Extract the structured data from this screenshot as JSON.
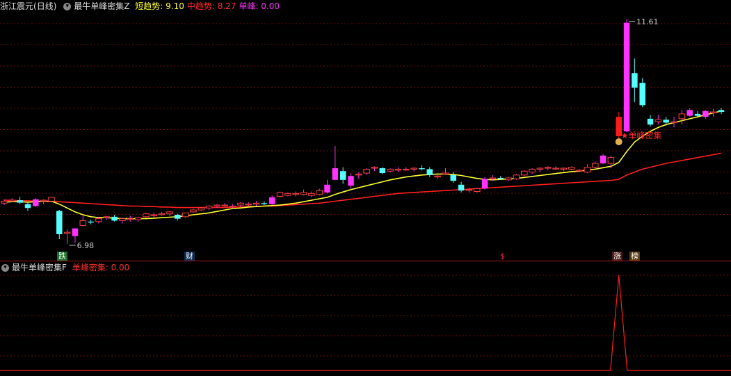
{
  "stock": {
    "name": "浙江震元",
    "period": "(日线)"
  },
  "main_indicator": {
    "name": "最牛单峰密集Z",
    "items": [
      {
        "label": "短趋势",
        "value": "9.10",
        "color": "#ffff33"
      },
      {
        "label": "中趋势",
        "value": "8.27",
        "color": "#ff3030"
      },
      {
        "label": "单峰",
        "value": "0.00",
        "color": "#ff33ff"
      }
    ]
  },
  "sub_indicator": {
    "name": "最牛单峰密集F",
    "items": [
      {
        "label": "单峰密集",
        "value": "0.00",
        "color": "#ff3030"
      }
    ]
  },
  "annotations": {
    "high_label": "11.61",
    "low_label": "6.98",
    "signal_label": "单峰密集",
    "markers": [
      {
        "text": "跌",
        "bg": "#1a6e2a",
        "fg": "#ffffff"
      },
      {
        "text": "财",
        "bg": "#0a2a55",
        "fg": "#ffffff"
      },
      {
        "text": "$",
        "bg": "#000000",
        "fg": "#ff3030"
      },
      {
        "text": "涨",
        "bg": "#4a1a1a",
        "fg": "#ffffff"
      },
      {
        "text": "榜",
        "bg": "#5a3a10",
        "fg": "#ffffff"
      }
    ]
  },
  "colors": {
    "up": "#ff33ff",
    "down": "#55ffff",
    "up_small": "#ff4040",
    "ma_short": "#ffff33",
    "ma_mid": "#ff2020"
  },
  "chart_data": {
    "type": "candlestick",
    "candles": [
      [
        7.82,
        7.9,
        7.78,
        7.86
      ],
      [
        7.86,
        7.92,
        7.84,
        7.88
      ],
      [
        7.88,
        7.95,
        7.8,
        7.83
      ],
      [
        7.8,
        7.84,
        7.66,
        7.72
      ],
      [
        7.76,
        7.92,
        7.74,
        7.9
      ],
      [
        7.87,
        7.9,
        7.8,
        7.88
      ],
      [
        7.86,
        7.94,
        7.84,
        7.94
      ],
      [
        7.66,
        7.68,
        7.08,
        7.18
      ],
      [
        7.2,
        7.28,
        6.98,
        7.22
      ],
      [
        7.14,
        7.3,
        7.0,
        7.3
      ],
      [
        7.36,
        7.56,
        7.34,
        7.46
      ],
      [
        7.44,
        7.48,
        7.38,
        7.42
      ],
      [
        7.44,
        7.54,
        7.4,
        7.5
      ],
      [
        7.52,
        7.56,
        7.48,
        7.54
      ],
      [
        7.54,
        7.58,
        7.44,
        7.46
      ],
      [
        7.46,
        7.52,
        7.4,
        7.5
      ],
      [
        7.5,
        7.56,
        7.44,
        7.5
      ],
      [
        7.48,
        7.54,
        7.44,
        7.52
      ],
      [
        7.54,
        7.62,
        7.52,
        7.6
      ],
      [
        7.58,
        7.62,
        7.52,
        7.58
      ],
      [
        7.6,
        7.64,
        7.56,
        7.6
      ],
      [
        7.6,
        7.66,
        7.56,
        7.64
      ],
      [
        7.58,
        7.6,
        7.46,
        7.5
      ],
      [
        7.54,
        7.62,
        7.52,
        7.62
      ],
      [
        7.64,
        7.7,
        7.62,
        7.68
      ],
      [
        7.68,
        7.74,
        7.66,
        7.72
      ],
      [
        7.72,
        7.78,
        7.68,
        7.76
      ],
      [
        7.76,
        7.8,
        7.72,
        7.78
      ],
      [
        7.78,
        7.82,
        7.74,
        7.78
      ],
      [
        7.76,
        7.8,
        7.72,
        7.76
      ],
      [
        7.78,
        7.84,
        7.74,
        7.82
      ],
      [
        7.8,
        7.84,
        7.76,
        7.8
      ],
      [
        7.8,
        7.86,
        7.76,
        7.82
      ],
      [
        7.82,
        7.86,
        7.78,
        7.8
      ],
      [
        7.8,
        7.98,
        7.78,
        7.94
      ],
      [
        7.96,
        8.06,
        7.94,
        8.04
      ],
      [
        7.98,
        8.04,
        7.96,
        8.02
      ],
      [
        8.0,
        8.06,
        7.96,
        8.02
      ],
      [
        8.0,
        8.1,
        7.98,
        8.04
      ],
      [
        7.98,
        8.06,
        7.94,
        8.02
      ],
      [
        8.0,
        8.12,
        7.98,
        8.08
      ],
      [
        8.04,
        8.3,
        8.02,
        8.2
      ],
      [
        8.3,
        9.0,
        8.3,
        8.54
      ],
      [
        8.48,
        8.56,
        8.22,
        8.3
      ],
      [
        8.18,
        8.44,
        8.12,
        8.38
      ],
      [
        8.4,
        8.46,
        8.32,
        8.42
      ],
      [
        8.44,
        8.54,
        8.4,
        8.52
      ],
      [
        8.54,
        8.58,
        8.48,
        8.56
      ],
      [
        8.54,
        8.56,
        8.42,
        8.44
      ],
      [
        8.48,
        8.54,
        8.46,
        8.52
      ],
      [
        8.5,
        8.56,
        8.46,
        8.52
      ],
      [
        8.52,
        8.56,
        8.48,
        8.52
      ],
      [
        8.52,
        8.56,
        8.48,
        8.54
      ],
      [
        8.54,
        8.6,
        8.5,
        8.52
      ],
      [
        8.52,
        8.56,
        8.36,
        8.4
      ],
      [
        8.36,
        8.44,
        8.32,
        8.38
      ],
      [
        8.42,
        8.54,
        8.4,
        8.44
      ],
      [
        8.4,
        8.46,
        8.24,
        8.28
      ],
      [
        8.2,
        8.26,
        8.04,
        8.08
      ],
      [
        8.1,
        8.14,
        8.04,
        8.1
      ],
      [
        8.06,
        8.14,
        8.04,
        8.12
      ],
      [
        8.12,
        8.36,
        8.1,
        8.32
      ],
      [
        8.32,
        8.4,
        8.28,
        8.34
      ],
      [
        8.34,
        8.38,
        8.3,
        8.32
      ],
      [
        8.3,
        8.36,
        8.28,
        8.34
      ],
      [
        8.32,
        8.42,
        8.3,
        8.4
      ],
      [
        8.4,
        8.5,
        8.38,
        8.48
      ],
      [
        8.46,
        8.54,
        8.42,
        8.52
      ],
      [
        8.52,
        8.56,
        8.46,
        8.54
      ],
      [
        8.54,
        8.58,
        8.5,
        8.56
      ],
      [
        8.54,
        8.58,
        8.5,
        8.54
      ],
      [
        8.52,
        8.56,
        8.48,
        8.54
      ],
      [
        8.52,
        8.58,
        8.5,
        8.56
      ],
      [
        8.5,
        8.52,
        8.46,
        8.5
      ],
      [
        8.46,
        8.62,
        8.44,
        8.56
      ],
      [
        8.56,
        8.68,
        8.52,
        8.64
      ],
      [
        8.64,
        8.84,
        8.62,
        8.8
      ],
      [
        8.64,
        8.8,
        8.54,
        8.76
      ],
      [
        9.6,
        9.7,
        9.16,
        9.2
      ],
      [
        9.3,
        11.61,
        9.28,
        11.54
      ],
      [
        10.5,
        10.8,
        9.9,
        10.2
      ],
      [
        10.3,
        10.4,
        9.8,
        9.84
      ],
      [
        9.56,
        9.64,
        9.4,
        9.44
      ],
      [
        9.5,
        9.64,
        9.44,
        9.54
      ],
      [
        9.54,
        9.6,
        9.42,
        9.48
      ],
      [
        9.48,
        9.6,
        9.38,
        9.5
      ],
      [
        9.56,
        9.74,
        9.44,
        9.66
      ],
      [
        9.62,
        9.78,
        9.6,
        9.74
      ],
      [
        9.66,
        9.72,
        9.58,
        9.62
      ],
      [
        9.6,
        9.74,
        9.56,
        9.72
      ],
      [
        9.68,
        9.76,
        9.6,
        9.7
      ],
      [
        9.74,
        9.78,
        9.66,
        9.7
      ]
    ],
    "ma_short": [
      7.84,
      7.85,
      7.85,
      7.84,
      7.85,
      7.86,
      7.86,
      7.8,
      7.72,
      7.64,
      7.58,
      7.54,
      7.52,
      7.52,
      7.51,
      7.5,
      7.5,
      7.5,
      7.5,
      7.51,
      7.52,
      7.53,
      7.54,
      7.56,
      7.58,
      7.6,
      7.62,
      7.65,
      7.68,
      7.71,
      7.72,
      7.74,
      7.75,
      7.76,
      7.77,
      7.78,
      7.8,
      7.82,
      7.85,
      7.88,
      7.91,
      7.94,
      8.0,
      8.05,
      8.1,
      8.14,
      8.18,
      8.22,
      8.26,
      8.3,
      8.33,
      8.36,
      8.38,
      8.4,
      8.41,
      8.42,
      8.42,
      8.41,
      8.39,
      8.36,
      8.33,
      8.31,
      8.3,
      8.31,
      8.32,
      8.33,
      8.35,
      8.37,
      8.39,
      8.41,
      8.43,
      8.45,
      8.47,
      8.48,
      8.5,
      8.52,
      8.55,
      8.58,
      8.66,
      8.88,
      9.08,
      9.2,
      9.3,
      9.38,
      9.44,
      9.48,
      9.52,
      9.56,
      9.6,
      9.64,
      9.68,
      9.72
    ],
    "ma_mid": [
      7.88,
      7.88,
      7.87,
      7.87,
      7.86,
      7.86,
      7.85,
      7.85,
      7.84,
      7.83,
      7.82,
      7.81,
      7.8,
      7.79,
      7.78,
      7.77,
      7.76,
      7.76,
      7.75,
      7.75,
      7.74,
      7.74,
      7.73,
      7.73,
      7.73,
      7.73,
      7.73,
      7.73,
      7.73,
      7.74,
      7.74,
      7.75,
      7.75,
      7.76,
      7.76,
      7.77,
      7.78,
      7.79,
      7.8,
      7.81,
      7.82,
      7.84,
      7.86,
      7.88,
      7.9,
      7.92,
      7.94,
      7.96,
      7.98,
      8.0,
      8.02,
      8.03,
      8.04,
      8.05,
      8.06,
      8.07,
      8.08,
      8.09,
      8.1,
      8.11,
      8.12,
      8.13,
      8.14,
      8.15,
      8.16,
      8.17,
      8.18,
      8.19,
      8.2,
      8.21,
      8.22,
      8.23,
      8.24,
      8.25,
      8.26,
      8.27,
      8.28,
      8.29,
      8.31,
      8.4,
      8.46,
      8.52,
      8.56,
      8.6,
      8.64,
      8.67,
      8.7,
      8.73,
      8.76,
      8.79,
      8.82,
      8.85
    ],
    "signal": {
      "peak_index": 78,
      "value": 1
    }
  }
}
